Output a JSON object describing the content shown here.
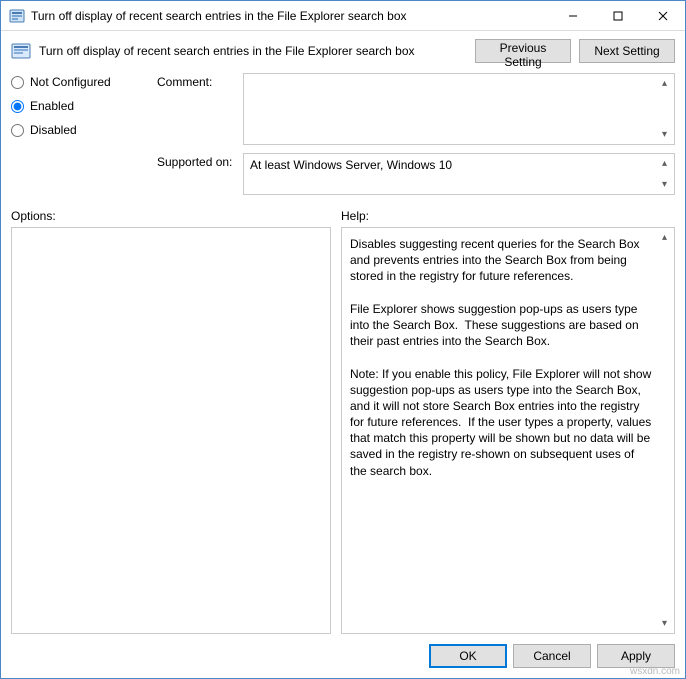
{
  "window": {
    "title": "Turn off display of recent search entries in the File Explorer search box"
  },
  "header": {
    "policy_title": "Turn off display of recent search entries in the File Explorer search box"
  },
  "nav": {
    "previous": "Previous Setting",
    "next": "Next Setting"
  },
  "state": {
    "not_configured_label": "Not Configured",
    "enabled_label": "Enabled",
    "disabled_label": "Disabled",
    "selected": "enabled"
  },
  "labels": {
    "comment": "Comment:",
    "supported_on": "Supported on:",
    "options": "Options:",
    "help": "Help:"
  },
  "comment": "",
  "supported_on": "At least Windows Server, Windows 10",
  "options_text": "",
  "help_text": "Disables suggesting recent queries for the Search Box and prevents entries into the Search Box from being stored in the registry for future references.\n\nFile Explorer shows suggestion pop-ups as users type into the Search Box.  These suggestions are based on their past entries into the Search Box.\n\nNote: If you enable this policy, File Explorer will not show suggestion pop-ups as users type into the Search Box, and it will not store Search Box entries into the registry for future references.  If the user types a property, values that match this property will be shown but no data will be saved in the registry re-shown on subsequent uses of the search box.",
  "footer": {
    "ok": "OK",
    "cancel": "Cancel",
    "apply": "Apply"
  },
  "watermark": "wsxdn.com"
}
